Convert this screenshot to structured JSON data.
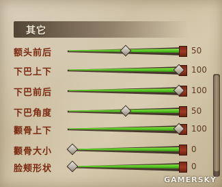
{
  "section": {
    "title": "其它"
  },
  "sliders": [
    {
      "label": "额头前后",
      "value": 50,
      "value_text": "50"
    },
    {
      "label": "下巴上下",
      "value": 100,
      "value_text": "100"
    },
    {
      "label": "下巴前后",
      "value": 100,
      "value_text": "100"
    },
    {
      "label": "下巴角度",
      "value": 50,
      "value_text": "50"
    },
    {
      "label": "颧骨上下",
      "value": 100,
      "value_text": "100"
    },
    {
      "label": "颧骨大小",
      "value": 0,
      "value_text": "0"
    },
    {
      "label": "脸颊形状",
      "value": 0,
      "value_text": "0"
    }
  ],
  "watermark": "GAMERSKY"
}
